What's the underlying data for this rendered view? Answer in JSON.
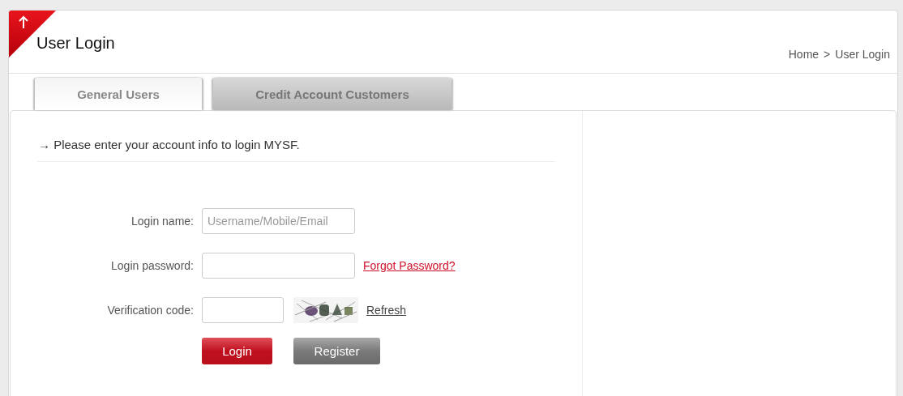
{
  "header": {
    "title": "User Login",
    "breadcrumb": {
      "items": [
        "Home",
        "User Login"
      ],
      "separator": ">"
    }
  },
  "tabs": [
    {
      "label": "General Users",
      "selected": true
    },
    {
      "label": "Credit Account Customers",
      "selected": false
    }
  ],
  "intro": "→ Please enter your account info to login MYSF.",
  "form": {
    "fields": [
      {
        "kind": "text",
        "label": "Login name:",
        "placeholder": "Username/Mobile/Email"
      },
      {
        "kind": "password",
        "label": "Login password:",
        "link": "Forgot Password?"
      },
      {
        "kind": "captcha",
        "label": "Verification code:",
        "link": "Refresh"
      }
    ],
    "buttons": [
      {
        "label": "Login",
        "kind": "primary"
      },
      {
        "label": "Register",
        "kind": "secondary"
      }
    ]
  }
}
